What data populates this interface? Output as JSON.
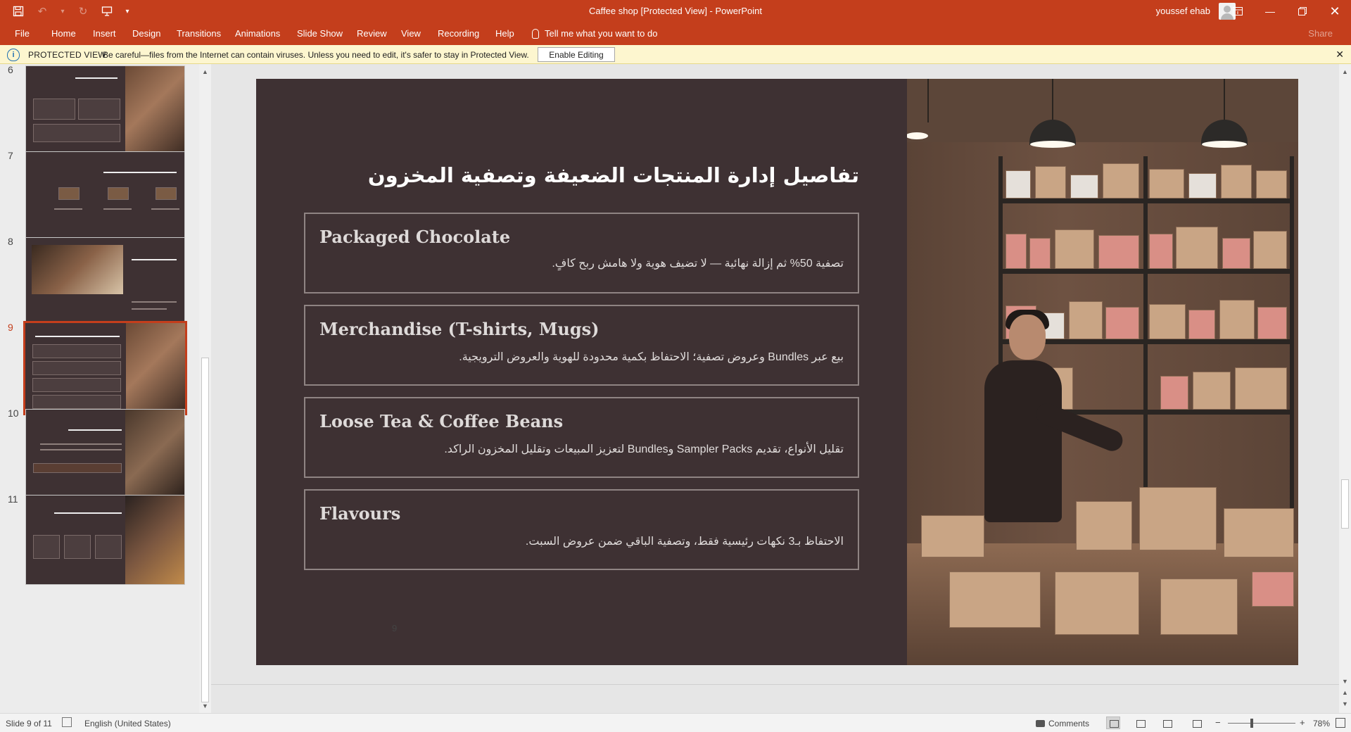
{
  "app": {
    "window_title": "Caffee shop [Protected View]  -  PowerPoint",
    "user_name": "youssef ehab"
  },
  "quick_access": {
    "save_icon": "save-icon",
    "undo_icon": "undo-icon",
    "redo_icon": "redo-icon",
    "present_icon": "present-from-start-icon",
    "customize_icon": "customize-qat-icon"
  },
  "ribbon": {
    "tabs": [
      "File",
      "Home",
      "Insert",
      "Design",
      "Transitions",
      "Animations",
      "Slide Show",
      "Review",
      "View",
      "Recording",
      "Help"
    ],
    "tell_me": "Tell me what you want to do",
    "share": "Share"
  },
  "protected_view": {
    "label": "PROTECTED VIEW",
    "message": "Be careful—files from the Internet can contain viruses. Unless you need to edit, it's safer to stay in Protected View.",
    "enable_button": "Enable Editing",
    "close": "✕"
  },
  "thumbnails": {
    "items": [
      {
        "number": "6"
      },
      {
        "number": "7"
      },
      {
        "number": "8"
      },
      {
        "number": "9",
        "selected": true
      },
      {
        "number": "10"
      },
      {
        "number": "11"
      }
    ]
  },
  "slide": {
    "title": "تفاصيل إدارة المنتجات الضعيفة وتصفية المخزون",
    "cards": [
      {
        "heading": "Packaged Chocolate",
        "body": "تصفية 50% ثم إزالة نهائية — لا تضيف هوية ولا هامش ربح كافٍ."
      },
      {
        "heading": "Merchandise (T-shirts, Mugs)",
        "body": "بيع عبر Bundles وعروض تصفية؛ الاحتفاظ بكمية محدودة للهوية والعروض الترويجية."
      },
      {
        "heading": "Loose Tea & Coffee Beans",
        "body": "تقليل الأنواع، تقديم Sampler Packs وBundles لتعزيز المبيعات وتقليل المخزون الراكد."
      },
      {
        "heading": "Flavours",
        "body": "الاحتفاظ بـ3 نكهات رئيسية فقط، وتصفية الباقي ضمن عروض السبت."
      }
    ],
    "slide_number_label": "9"
  },
  "statusbar": {
    "slide_info": "Slide 9 of 11",
    "language": "English (United States)",
    "comments": "Comments",
    "zoom": "78%",
    "zoom_fraction": 0.78
  },
  "colors": {
    "accent": "#c43e1c",
    "slide_background": "#3e3133",
    "protected_bar": "#fdf6cf"
  }
}
